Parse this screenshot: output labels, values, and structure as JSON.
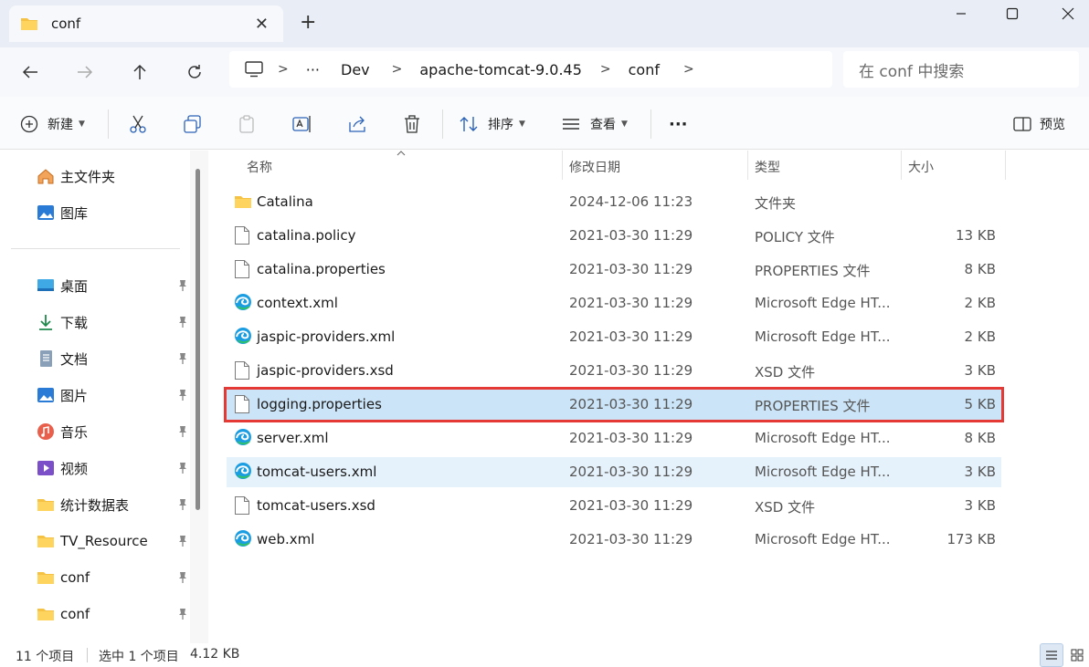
{
  "tab": {
    "title": "conf"
  },
  "address": {
    "more": "···",
    "crumbs": [
      "Dev",
      "apache-tomcat-9.0.45",
      "conf"
    ]
  },
  "search": {
    "placeholder": "在 conf 中搜索"
  },
  "toolbar": {
    "new_label": "新建",
    "sort_label": "排序",
    "view_label": "查看",
    "more_label": "···",
    "preview_label": "预览"
  },
  "sidebar": {
    "top_items": [
      {
        "label": "主文件夹",
        "icon": "home-icon"
      },
      {
        "label": "图库",
        "icon": "gallery-icon"
      }
    ],
    "pinned_items": [
      {
        "label": "桌面",
        "icon": "desktop-icon"
      },
      {
        "label": "下载",
        "icon": "download-icon"
      },
      {
        "label": "文档",
        "icon": "document-icon"
      },
      {
        "label": "图片",
        "icon": "pictures-icon"
      },
      {
        "label": "音乐",
        "icon": "music-icon"
      },
      {
        "label": "视频",
        "icon": "video-icon"
      },
      {
        "label": "统计数据表",
        "icon": "folder-icon"
      },
      {
        "label": "TV_Resource",
        "icon": "folder-icon"
      },
      {
        "label": "conf",
        "icon": "folder-icon"
      },
      {
        "label": "conf",
        "icon": "folder-icon"
      }
    ]
  },
  "columns": {
    "name": "名称",
    "date": "修改日期",
    "type": "类型",
    "size": "大小"
  },
  "files": [
    {
      "name": "Catalina",
      "date": "2024-12-06 11:23",
      "type": "文件夹",
      "size": "",
      "icon": "folder-icon"
    },
    {
      "name": "catalina.policy",
      "date": "2021-03-30 11:29",
      "type": "POLICY 文件",
      "size": "13 KB",
      "icon": "file-icon"
    },
    {
      "name": "catalina.properties",
      "date": "2021-03-30 11:29",
      "type": "PROPERTIES 文件",
      "size": "8 KB",
      "icon": "file-icon"
    },
    {
      "name": "context.xml",
      "date": "2021-03-30 11:29",
      "type": "Microsoft Edge HT...",
      "size": "2 KB",
      "icon": "edge-icon"
    },
    {
      "name": "jaspic-providers.xml",
      "date": "2021-03-30 11:29",
      "type": "Microsoft Edge HT...",
      "size": "2 KB",
      "icon": "edge-icon"
    },
    {
      "name": "jaspic-providers.xsd",
      "date": "2021-03-30 11:29",
      "type": "XSD 文件",
      "size": "3 KB",
      "icon": "file-icon"
    },
    {
      "name": "logging.properties",
      "date": "2021-03-30 11:29",
      "type": "PROPERTIES 文件",
      "size": "5 KB",
      "icon": "file-icon",
      "state": "selected"
    },
    {
      "name": "server.xml",
      "date": "2021-03-30 11:29",
      "type": "Microsoft Edge HT...",
      "size": "8 KB",
      "icon": "edge-icon"
    },
    {
      "name": "tomcat-users.xml",
      "date": "2021-03-30 11:29",
      "type": "Microsoft Edge HT...",
      "size": "3 KB",
      "icon": "edge-icon",
      "state": "hover"
    },
    {
      "name": "tomcat-users.xsd",
      "date": "2021-03-30 11:29",
      "type": "XSD 文件",
      "size": "3 KB",
      "icon": "file-icon"
    },
    {
      "name": "web.xml",
      "date": "2021-03-30 11:29",
      "type": "Microsoft Edge HT...",
      "size": "173 KB",
      "icon": "edge-icon"
    }
  ],
  "status": {
    "count": "11 个项目",
    "selection": "选中 1 个项目",
    "selection_size": "4.12 KB"
  },
  "colors": {
    "selection_bg": "#cce4f7",
    "highlight_border": "#e53935",
    "folder": "#f6c244",
    "accent": "#0067c0"
  }
}
